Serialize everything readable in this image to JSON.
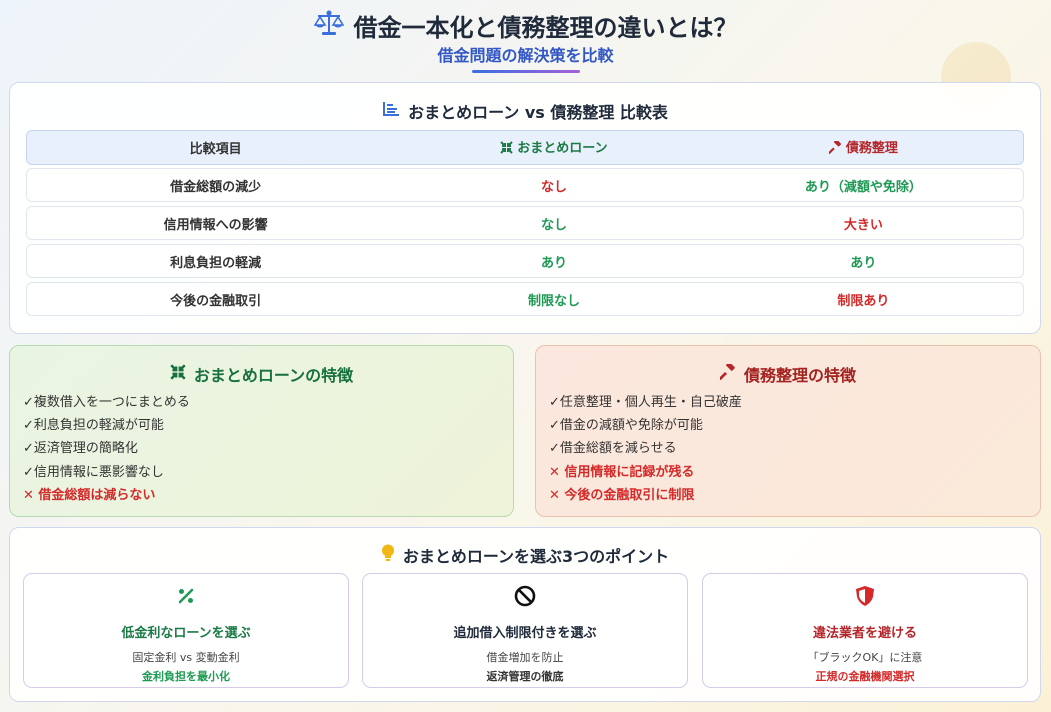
{
  "header": {
    "title": "借金一本化と債務整理の違いとは？",
    "subtitle": "借金問題の解決策を比較",
    "icon": "scale-icon"
  },
  "table": {
    "title": "おまとめローン vs 債務整理 比較表",
    "icon": "chart-bar-icon",
    "headers": [
      "比較項目",
      "おまとめローン",
      "債務整理"
    ],
    "rows": [
      {
        "item": "借金総額の減少",
        "loan": "なし",
        "debt": "あり（減額や免除）"
      },
      {
        "item": "信用情報への影響",
        "loan": "なし",
        "debt": "大きい"
      },
      {
        "item": "利息負担の軽減",
        "loan": "あり",
        "debt": "あり"
      },
      {
        "item": "今後の金融取引",
        "loan": "制限なし",
        "debt": "制限あり"
      }
    ]
  },
  "features": {
    "loan": {
      "title": "おまとめローンの特徴",
      "icon": "compress-icon",
      "items": [
        "✓複数借入を一つにまとめる",
        "✓利息負担の軽減が可能",
        "✓返済管理の簡略化",
        "✓信用情報に悪影響なし",
        "✕ 借金総額は減らない"
      ]
    },
    "debt": {
      "title": "債務整理の特徴",
      "icon": "gavel-icon",
      "items": [
        "✓任意整理・個人再生・自己破産",
        "✓借金の減額や免除が可能",
        "✓借金総額を減らせる",
        "✕ 信用情報に記録が残る",
        "✕ 今後の金融取引に制限"
      ]
    }
  },
  "points": {
    "title": "おまとめローンを選ぶ3つのポイント",
    "icon": "lightbulb-icon",
    "cards": [
      {
        "title": "低金利なローンを選ぶ",
        "line1": "固定金利 vs 変動金利",
        "line2": "金利負担を最小化",
        "icon": "percent-icon"
      },
      {
        "title": "追加借入制限付きを選ぶ",
        "line1": "借金増加を防止",
        "line2": "返済管理の徹底",
        "icon": "ban-icon"
      },
      {
        "title": "違法業者を避ける",
        "line1": "「ブラックOK」に注意",
        "line2": "正規の金融機関選択",
        "icon": "shield-icon"
      }
    ]
  },
  "colors": {
    "accent_blue": "#3358c4",
    "positive": "#1e9a54",
    "negative": "#d42a2a"
  }
}
